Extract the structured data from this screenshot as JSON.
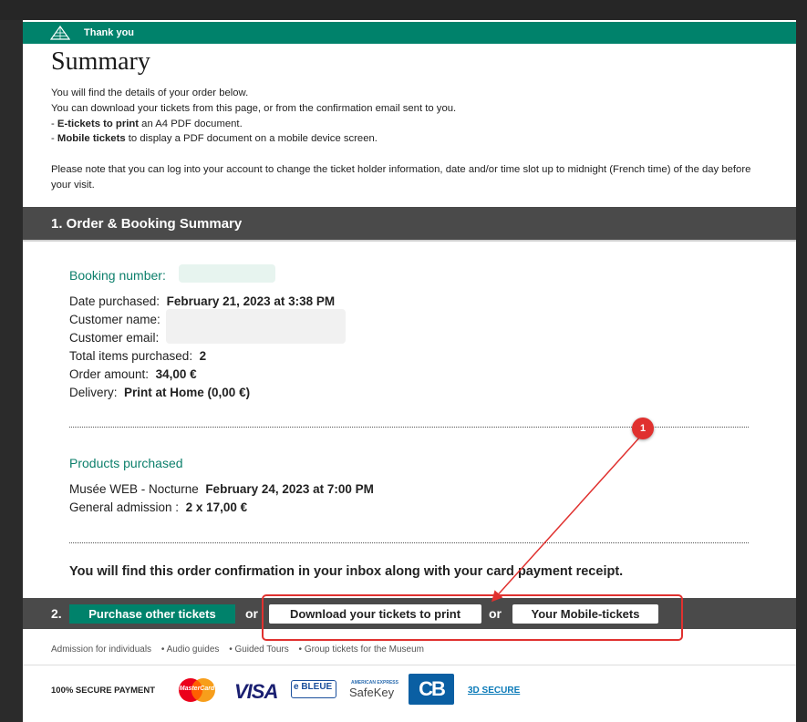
{
  "header": {
    "label": "Thank you"
  },
  "page_title": "Summary",
  "intro": {
    "line1": "You will find the details of your order below.",
    "line2": "You can download your tickets from this page, or from the confirmation email sent to you.",
    "eticket_bold": "E-tickets to print",
    "eticket_rest": " an A4 PDF document.",
    "mobile_bold": "Mobile tickets",
    "mobile_rest": " to display a PDF document on a mobile device screen.",
    "note": "Please note that you can log into your account to change the ticket holder information, date and/or time slot up to midnight (French time) of the day before your visit."
  },
  "section1": {
    "title": "1. Order & Booking Summary"
  },
  "booking": {
    "label": "Booking number:",
    "date_label": "Date purchased:",
    "date_value": "February 21, 2023 at 3:38 PM",
    "name_label": "Customer name:",
    "email_label": "Customer email:",
    "items_label": "Total items purchased:",
    "items_value": "2",
    "amount_label": "Order amount:",
    "amount_value": "34,00 €",
    "delivery_label": "Delivery:",
    "delivery_value": "Print at Home (0,00 €)"
  },
  "products": {
    "label": "Products purchased",
    "product_name": "Musée WEB - Nocturne",
    "product_date": "February 24, 2023 at 7:00 PM",
    "admission_label": "General admission :",
    "admission_value": "2 x 17,00 €"
  },
  "confirmation_text": "You will find this order confirmation in your inbox along with your card payment receipt.",
  "actions": {
    "step": "2.",
    "purchase_label": "Purchase other tickets",
    "or1": "or",
    "download_label": "Download your tickets to print",
    "or2": "or",
    "mobile_label": "Your Mobile-tickets"
  },
  "footer_links": [
    "Admission for individuals",
    "• Audio guides",
    "• Guided Tours",
    "• Group tickets for the Museum"
  ],
  "payment": {
    "label": "100% SECURE PAYMENT",
    "mastercard": "MasterCard",
    "visa": "VISA",
    "eblue": "e BLEUE",
    "amex_top": "AMERICAN EXPRESS",
    "safekey": "SafeKey",
    "cb": "CB",
    "secure_link": "3D SECURE"
  },
  "annotation": {
    "number": "1"
  },
  "colors": {
    "accent_green": "#00826b",
    "bar_gray": "#4a4a4a",
    "annotation_red": "#e0312f"
  }
}
